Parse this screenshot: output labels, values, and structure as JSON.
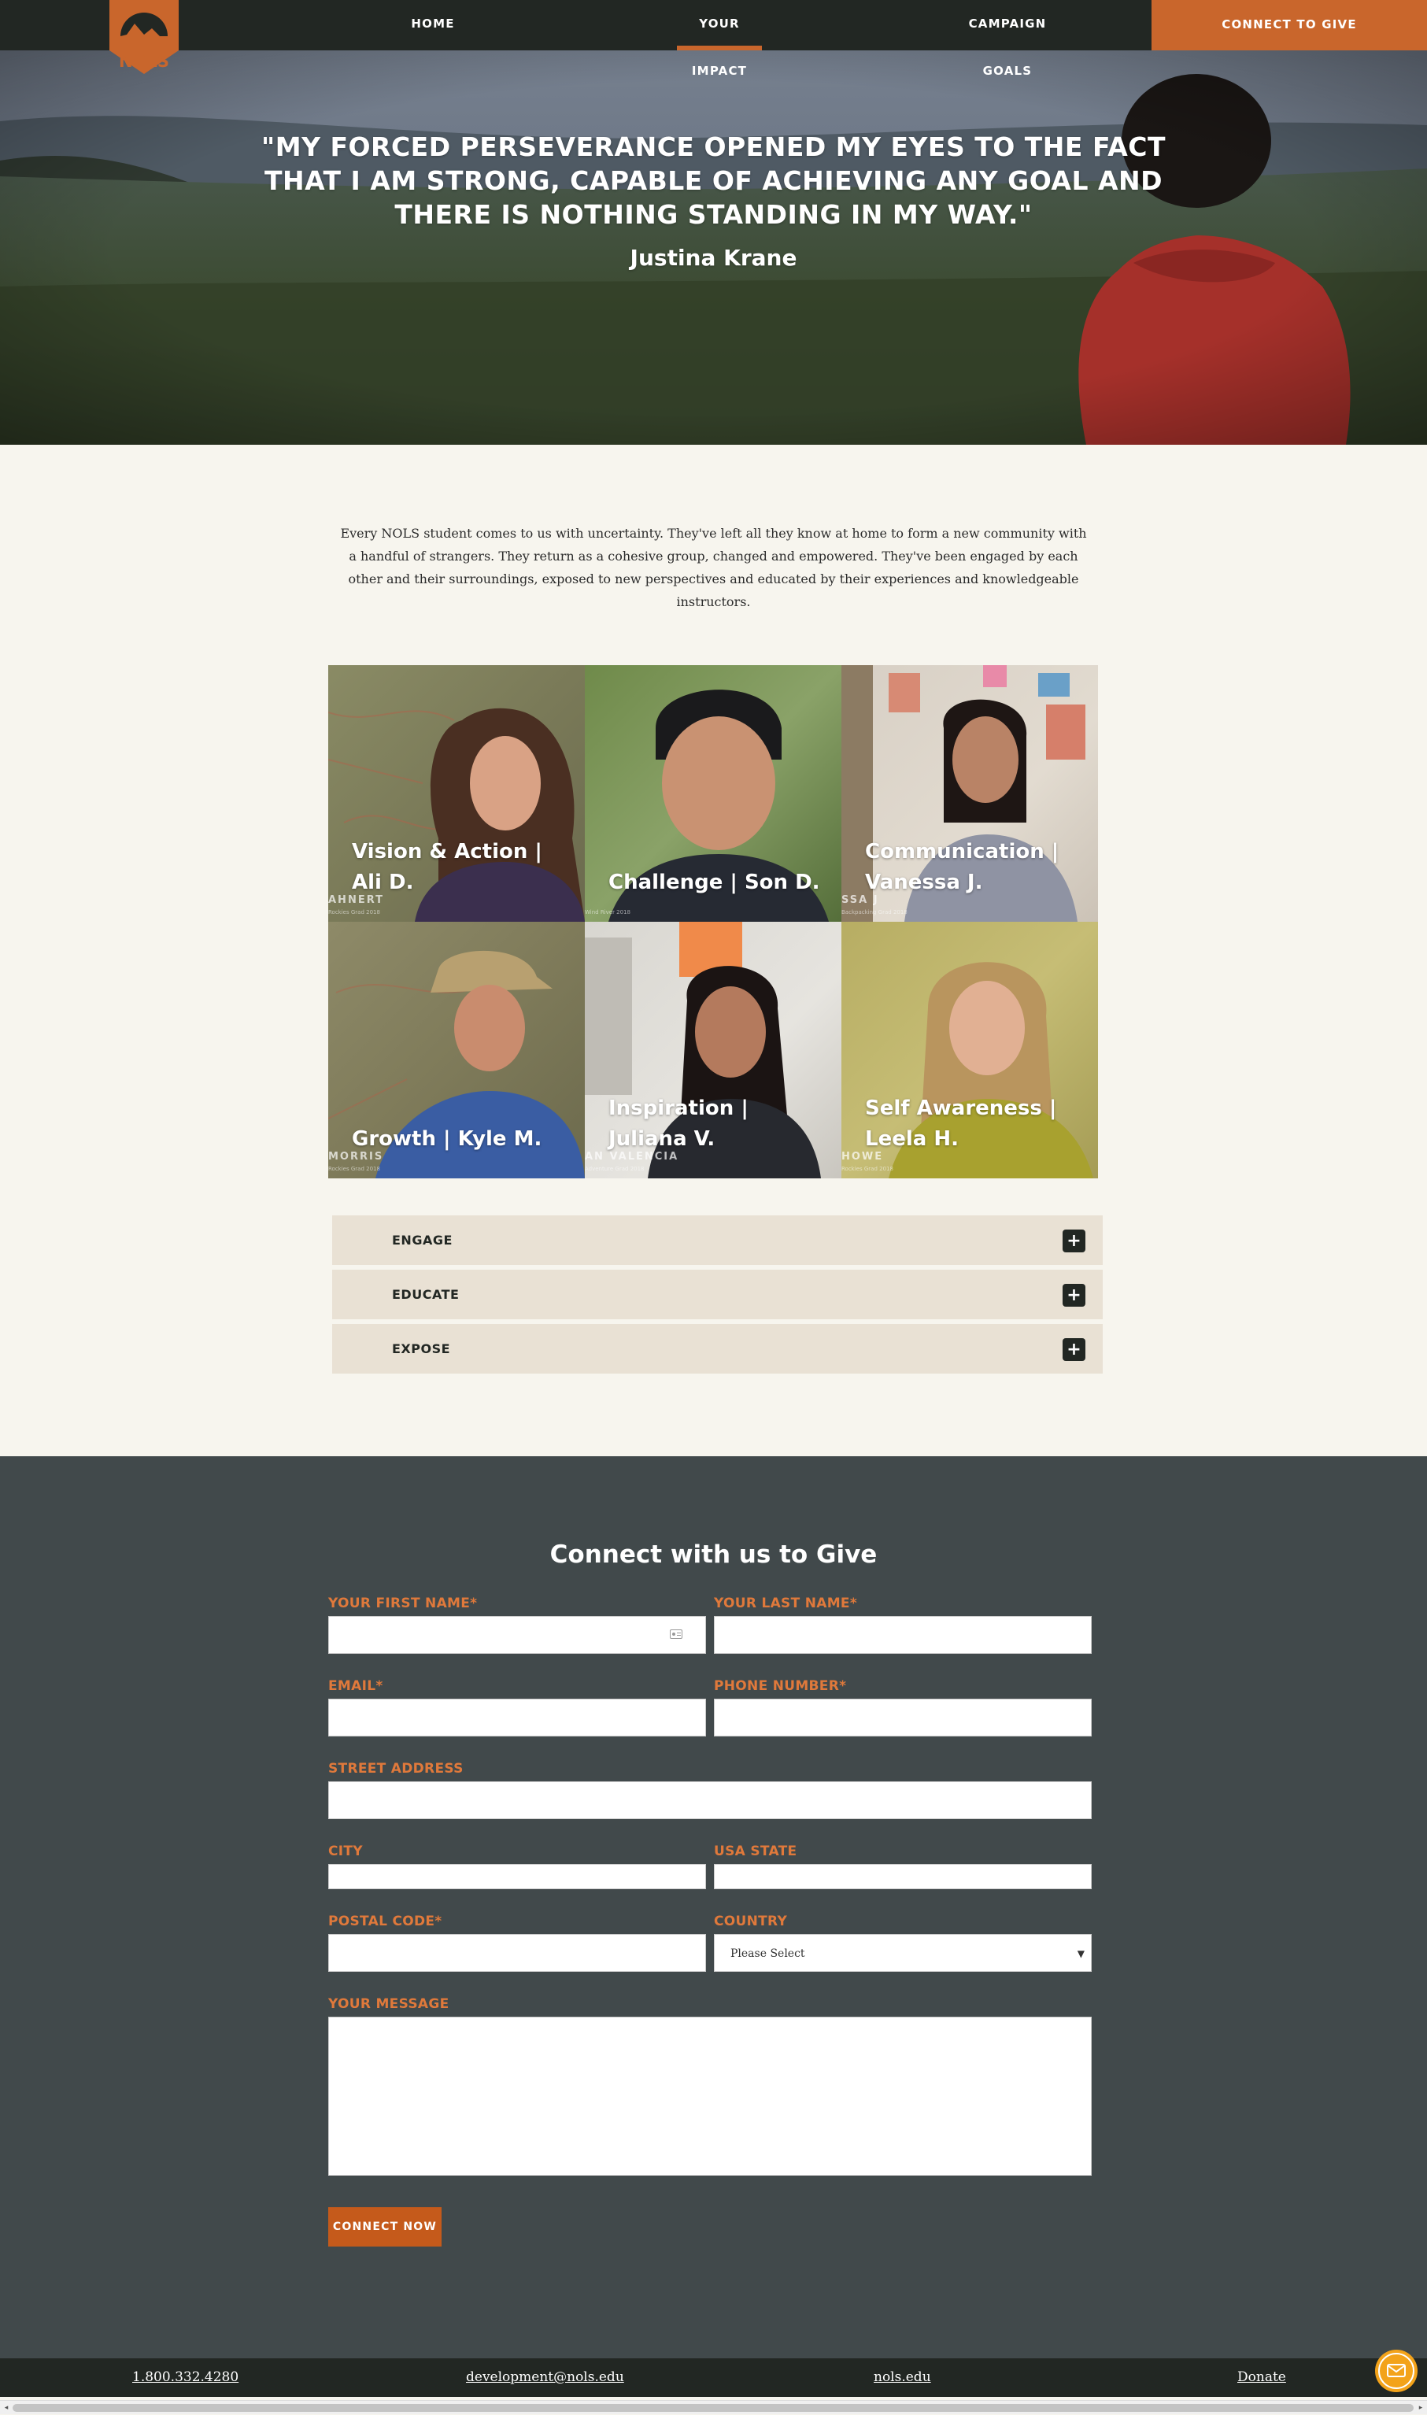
{
  "nav": {
    "logo_text": "NOLS",
    "links": [
      {
        "label": "HOME"
      },
      {
        "label": "YOUR IMPACT"
      },
      {
        "label": "CAMPAIGN GOALS"
      }
    ],
    "cta": "CONNECT TO GIVE"
  },
  "hero": {
    "quote": "\"My forced perseverance opened my eyes to the fact that I am strong, capable of achieving any goal and there is nothing standing in my way.\"",
    "author": "Justina Krane"
  },
  "intro": "Every NOLS student comes to us with uncertainty. They've left all they know at home to form a new community with a handful of strangers. They return as a cohesive group, changed and empowered. They've been engaged by each other and their surroundings, exposed to new perspectives and educated by their experiences and knowledgeable instructors.",
  "videos": [
    {
      "title": "Vision & Action | Ali D.",
      "watermark": "AHNERT",
      "caption": "Rockies Grad 2018"
    },
    {
      "title": "Challenge | Son D.",
      "watermark": "",
      "caption": "Wind River 2018"
    },
    {
      "title": "Communication | Vanessa J.",
      "watermark": "SSA J",
      "caption": "Backpacking Grad 2018"
    },
    {
      "title": "Growth | Kyle M.",
      "watermark": "MORRIS",
      "caption": "Rockies Grad 2018"
    },
    {
      "title": "Inspiration | Juliana V.",
      "watermark": "AN VALENCIA",
      "caption": "Adventure Grad 2018"
    },
    {
      "title": "Self Awareness | Leela H.",
      "watermark": "HOWE",
      "caption": "Rockies Grad 2018"
    }
  ],
  "accordion": [
    {
      "label": "ENGAGE"
    },
    {
      "label": "EDUCATE"
    },
    {
      "label": "EXPOSE"
    }
  ],
  "form": {
    "heading": "Connect with us to Give",
    "first_name": "YOUR FIRST NAME*",
    "last_name": "YOUR LAST NAME*",
    "email": "EMAIL*",
    "phone": "PHONE NUMBER*",
    "street": "STREET ADDRESS",
    "city": "CITY",
    "state": "USA STATE",
    "postal": "POSTAL CODE*",
    "country": "COUNTRY",
    "country_value": "Please Select",
    "message": "YOUR MESSAGE",
    "submit": "CONNECT NOW"
  },
  "footer": {
    "phone": "1.800.332.4280",
    "email": "development@nols.edu",
    "site": "nols.edu",
    "donate": "Donate"
  },
  "colors": {
    "nav_bg": "#222723",
    "accent": "#c9662c",
    "page_bg": "#f7f5ee",
    "accordion_bg": "#e9e1d4",
    "form_bg": "#41494b",
    "label": "#e0793b",
    "chat": "#f3a31a"
  }
}
